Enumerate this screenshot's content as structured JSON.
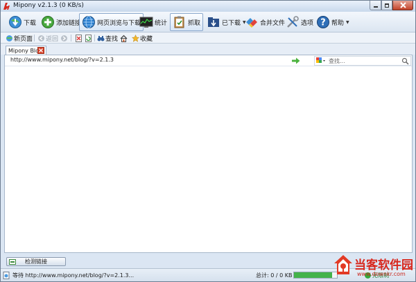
{
  "window": {
    "title": "Mipony v2.1.3 (0 KB/s)",
    "controls": [
      "minimize",
      "maximize",
      "close"
    ]
  },
  "toolbar": {
    "items": [
      {
        "label": "下载",
        "icon": "download-globe-icon"
      },
      {
        "label": "添加链接",
        "icon": "add-plus-icon"
      },
      {
        "label": "网页浏览与下载",
        "icon": "web-globe-icon",
        "active": true
      },
      {
        "label": "统计",
        "icon": "stats-monitor-icon"
      },
      {
        "label": "抓取",
        "icon": "grab-clipboard-icon",
        "active": true
      },
      {
        "label": "已下载",
        "icon": "downloaded-folder-icon",
        "dropdown": true
      },
      {
        "label": "合并文件",
        "icon": "merge-files-icon"
      },
      {
        "label": "选项",
        "icon": "options-tools-icon"
      },
      {
        "label": "帮助",
        "icon": "help-question-icon",
        "dropdown": true
      }
    ]
  },
  "nav": {
    "new_page": "新页面",
    "back": "返回",
    "find": "查找",
    "favorites": "收藏"
  },
  "tabs": [
    {
      "label": "Mipony Blog"
    }
  ],
  "browser": {
    "url": "http://www.mipony.net/blog/?v=2.1.3",
    "search_placeholder": "查找..."
  },
  "bottom": {
    "check_links_label": "检测链接"
  },
  "status": {
    "message": "等待 http://www.mipony.net/blog/?v=2.1.3...",
    "total": "总计: 0 / 0 KB",
    "progress": 0.88,
    "speed_partial": "无限制"
  },
  "watermark": {
    "cn": "当客软件园",
    "en": "www.downkr.com"
  },
  "colors": {
    "accent": "#2f6fb8",
    "close_red": "#c3432a",
    "progress_green": "#44b34a",
    "watermark_red": "#d8281e"
  }
}
